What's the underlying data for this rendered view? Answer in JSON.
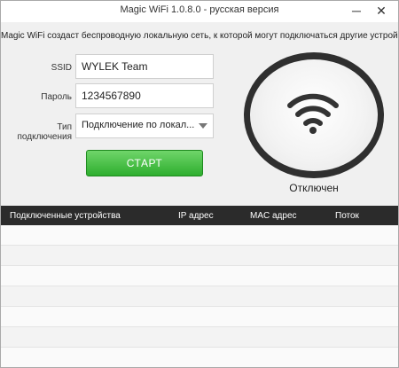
{
  "window": {
    "title": "Magic WiFi  1.0.8.0 - русская версия"
  },
  "description": "Magic WiFi создаст беспроводную локальную сеть, к которой могут подключаться другие устройства.",
  "form": {
    "ssid_label": "SSID",
    "ssid_value": "WYLEK Team",
    "password_label": "Пароль",
    "password_value": "1234567890",
    "connection_label": "Тип подключения",
    "connection_value": "Подключение по локал..."
  },
  "start_button": "СТАРТ",
  "status": {
    "text": "Отключен",
    "icon": "wifi-icon"
  },
  "table": {
    "headers": [
      "Подключенные устройства",
      "IP адрес",
      "MAC адрес",
      "Поток"
    ],
    "rows": []
  },
  "colors": {
    "start_green": "#2eae2e",
    "header_dark": "#2b2b2b",
    "ring_dark": "#2f2f2f"
  }
}
